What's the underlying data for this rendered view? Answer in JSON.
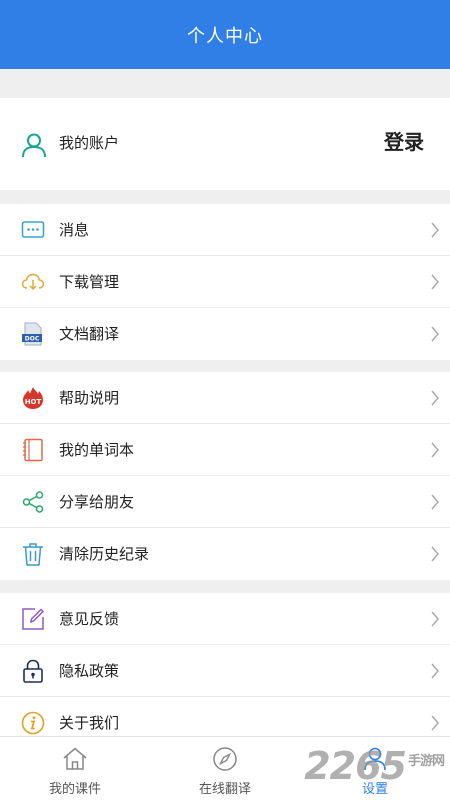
{
  "header": {
    "title": "个人中心"
  },
  "account": {
    "label": "我的账户",
    "login": "登录"
  },
  "groups": [
    {
      "items": [
        {
          "label": "消息",
          "icon": "message-icon"
        },
        {
          "label": "下载管理",
          "icon": "cloud-download-icon"
        },
        {
          "label": "文档翻译",
          "icon": "doc-file-icon"
        }
      ]
    },
    {
      "items": [
        {
          "label": "帮助说明",
          "icon": "hot-icon"
        },
        {
          "label": "我的单词本",
          "icon": "notebook-icon"
        },
        {
          "label": "分享给朋友",
          "icon": "share-icon"
        },
        {
          "label": "清除历史纪录",
          "icon": "trash-icon"
        }
      ]
    },
    {
      "items": [
        {
          "label": "意见反馈",
          "icon": "feedback-edit-icon"
        },
        {
          "label": "隐私政策",
          "icon": "lock-icon"
        },
        {
          "label": "关于我们",
          "icon": "info-icon"
        }
      ]
    }
  ],
  "tabbar": [
    {
      "label": "我的课件",
      "icon": "home-icon"
    },
    {
      "label": "在线翻译",
      "icon": "compass-icon"
    },
    {
      "label": "设置",
      "icon": "user-icon",
      "active": true
    }
  ],
  "watermark": {
    "text": "2265",
    "sub": "手游网"
  },
  "colors": {
    "accent": "#2f7fe6",
    "teal": "#1aa58f"
  }
}
